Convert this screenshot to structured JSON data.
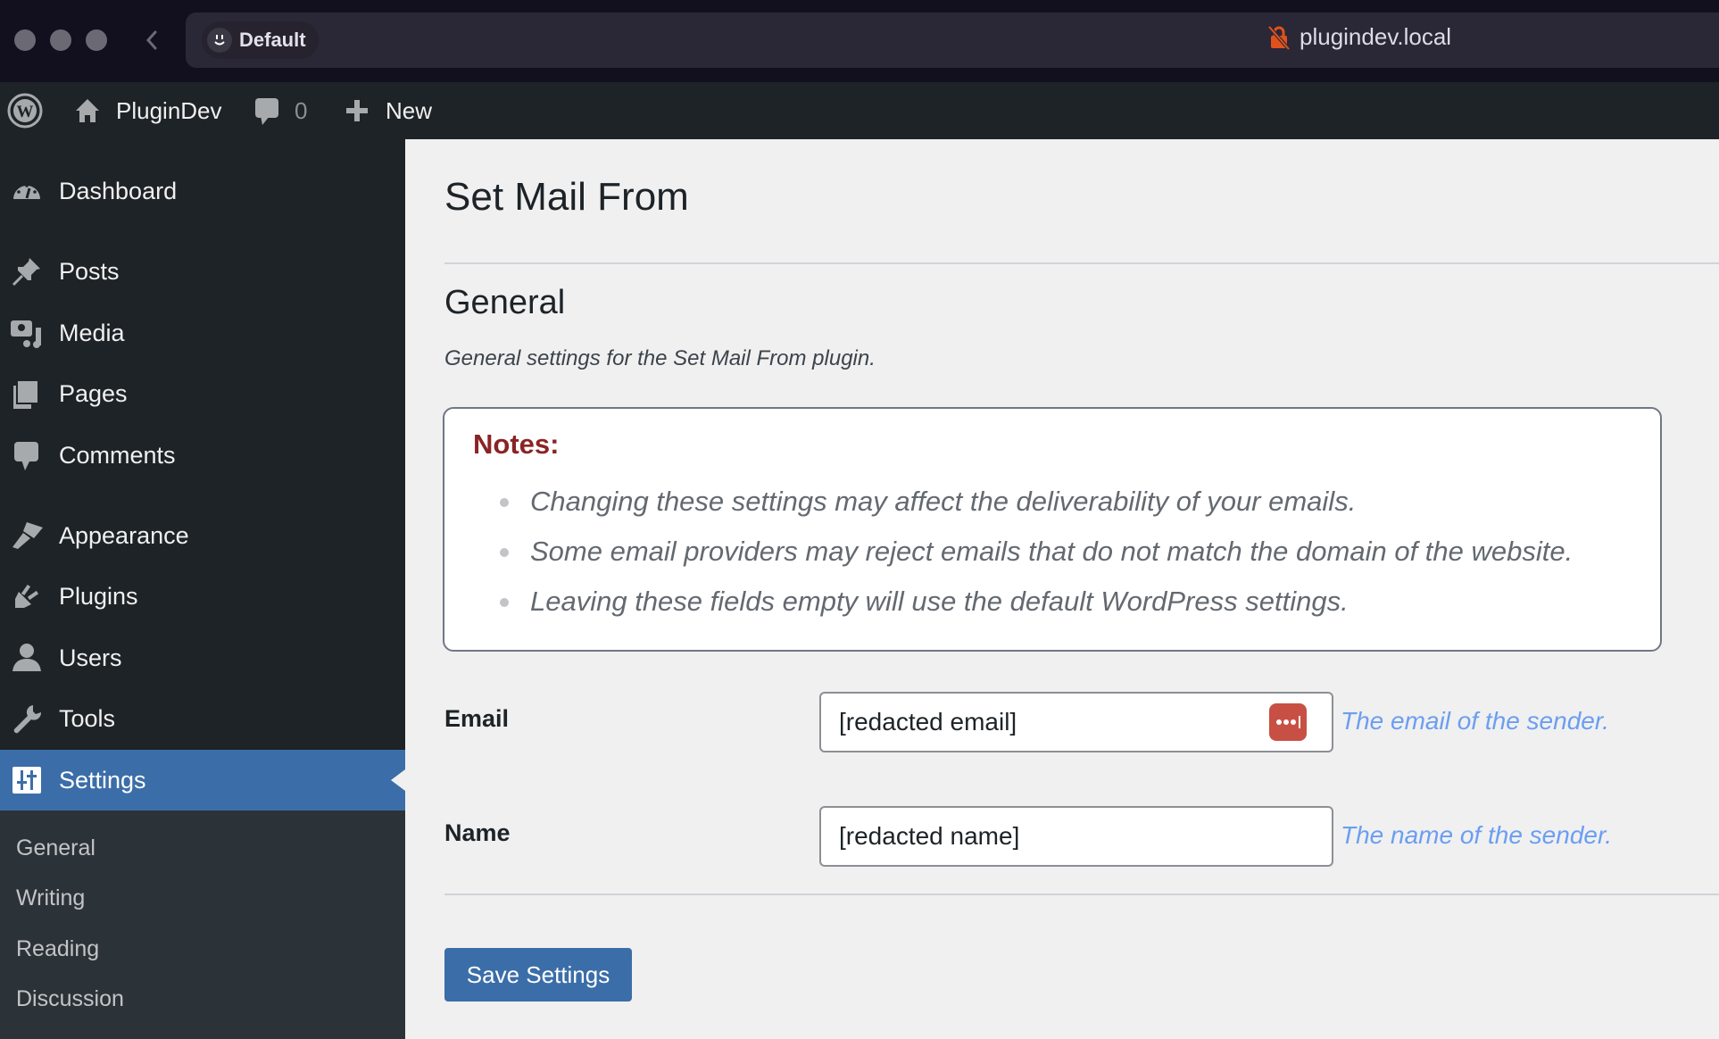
{
  "browser": {
    "profile_label": "Default",
    "url": "plugindev.local",
    "security_icon": "insecure-lock-icon"
  },
  "adminbar": {
    "site_name": "PluginDev",
    "comments_count": "0",
    "new_label": "New"
  },
  "sidebar": {
    "items": [
      {
        "label": "Dashboard",
        "icon": "dashboard-icon"
      },
      {
        "label": "Posts",
        "icon": "pushpin-icon"
      },
      {
        "label": "Media",
        "icon": "media-icon"
      },
      {
        "label": "Pages",
        "icon": "pages-icon"
      },
      {
        "label": "Comments",
        "icon": "comment-icon"
      },
      {
        "label": "Appearance",
        "icon": "paintbrush-icon"
      },
      {
        "label": "Plugins",
        "icon": "plugin-icon"
      },
      {
        "label": "Users",
        "icon": "user-icon"
      },
      {
        "label": "Tools",
        "icon": "wrench-icon"
      },
      {
        "label": "Settings",
        "icon": "settings-sliders-icon",
        "active": true
      }
    ],
    "submenu": [
      "General",
      "Writing",
      "Reading",
      "Discussion"
    ]
  },
  "main": {
    "page_title": "Set Mail From",
    "section_title": "General",
    "section_description": "General settings for the Set Mail From plugin.",
    "notes": {
      "title": "Notes:",
      "items": [
        "Changing these settings may affect the deliverability of your emails.",
        "Some email providers may reject emails that do not match the domain of the website.",
        "Leaving these fields empty will use the default WordPress settings."
      ]
    },
    "fields": [
      {
        "label": "Email",
        "value": "[redacted email]",
        "help": "The email of the sender."
      },
      {
        "label": "Name",
        "value": "[redacted name]",
        "help": "The name of the sender."
      }
    ],
    "save_label": "Save Settings"
  },
  "colors": {
    "accent": "#3b6ea8",
    "notes_title": "#8a2424",
    "help_text": "#6b9ef0",
    "password_badge": "#c84f43"
  }
}
